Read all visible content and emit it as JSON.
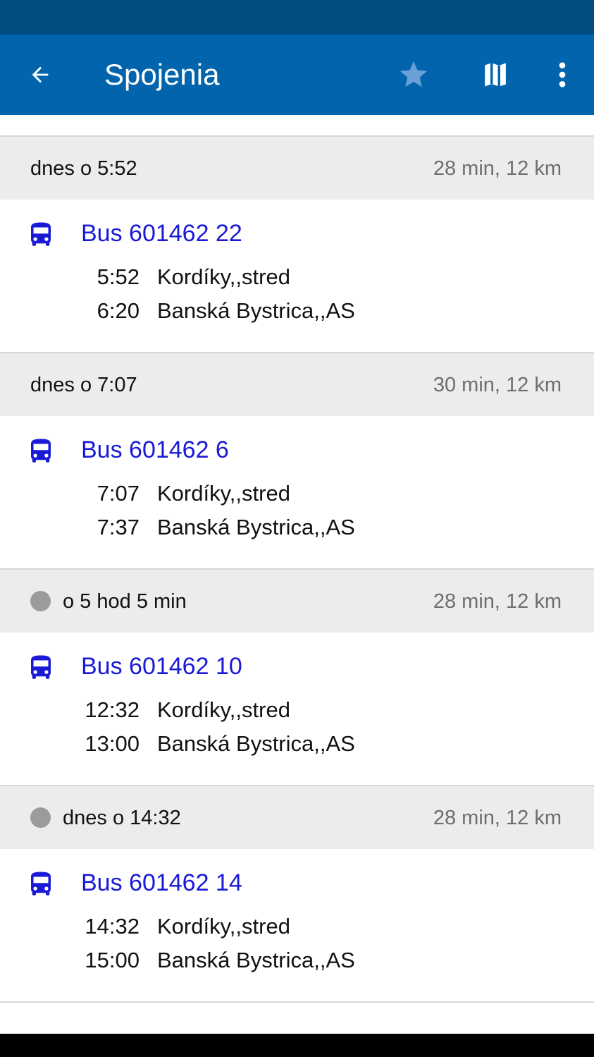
{
  "app_bar": {
    "title": "Spojenia",
    "back_icon": "arrow-left-icon",
    "favorite_icon": "star-icon",
    "map_icon": "map-icon",
    "more_icon": "more-vert-icon"
  },
  "colors": {
    "status_bar": "#014c80",
    "app_bar": "#0264ad",
    "star": "#6a9fd8",
    "bus_link": "#1a1ad6",
    "group_header_bg": "#ececec",
    "dot": "#9b9b9b"
  },
  "connections": [
    {
      "when": "dnes o 5:52",
      "duration": "28 min, 12 km",
      "has_dot": false,
      "line": "Bus 601462 22",
      "departure_time": "5:52",
      "departure_stop": "Kordíky,,stred",
      "arrival_time": "6:20",
      "arrival_stop": "Banská Bystrica,,AS"
    },
    {
      "when": "dnes o 7:07",
      "duration": "30 min, 12 km",
      "has_dot": false,
      "line": "Bus 601462 6",
      "departure_time": "7:07",
      "departure_stop": "Kordíky,,stred",
      "arrival_time": "7:37",
      "arrival_stop": "Banská Bystrica,,AS"
    },
    {
      "when": "o 5 hod 5 min",
      "duration": "28 min, 12 km",
      "has_dot": true,
      "line": "Bus 601462 10",
      "departure_time": "12:32",
      "departure_stop": "Kordíky,,stred",
      "arrival_time": "13:00",
      "arrival_stop": "Banská Bystrica,,AS"
    },
    {
      "when": "dnes o 14:32",
      "duration": "28 min, 12 km",
      "has_dot": true,
      "line": "Bus 601462 14",
      "departure_time": "14:32",
      "departure_stop": "Kordíky,,stred",
      "arrival_time": "15:00",
      "arrival_stop": "Banská Bystrica,,AS"
    }
  ]
}
